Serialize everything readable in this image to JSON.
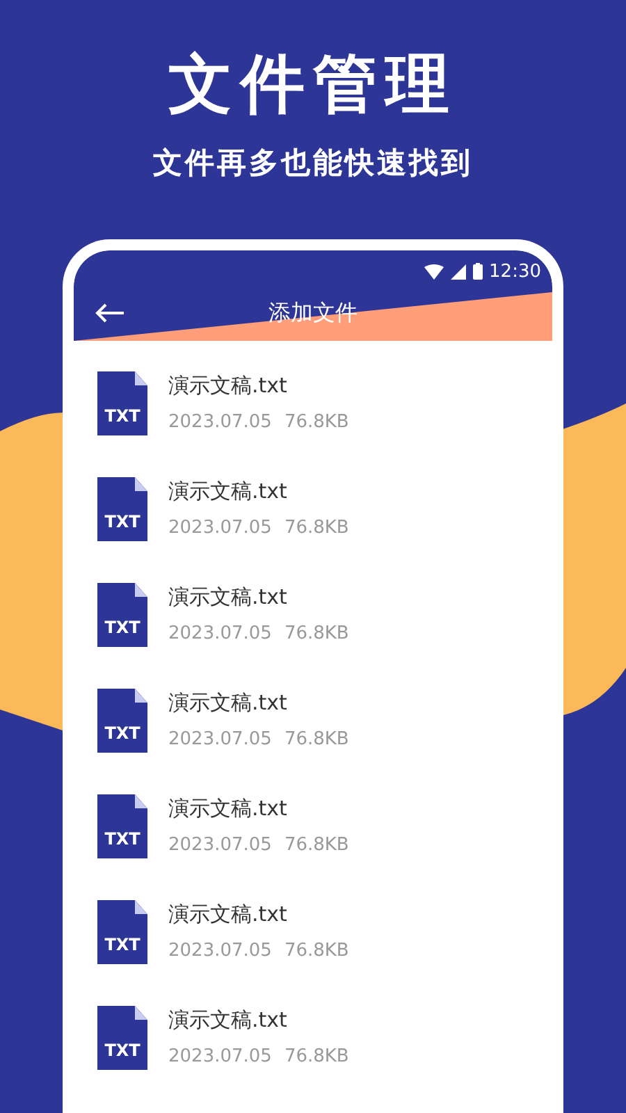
{
  "headline": "文件管理",
  "subheadline": "文件再多也能快速找到",
  "status_bar": {
    "time": "12:30"
  },
  "app_bar": {
    "title": "添加文件"
  },
  "files": [
    {
      "icon_label": "TXT",
      "name": "演示文稿.txt",
      "date": "2023.07.05",
      "size": "76.8KB"
    },
    {
      "icon_label": "TXT",
      "name": "演示文稿.txt",
      "date": "2023.07.05",
      "size": "76.8KB"
    },
    {
      "icon_label": "TXT",
      "name": "演示文稿.txt",
      "date": "2023.07.05",
      "size": "76.8KB"
    },
    {
      "icon_label": "TXT",
      "name": "演示文稿.txt",
      "date": "2023.07.05",
      "size": "76.8KB"
    },
    {
      "icon_label": "TXT",
      "name": "演示文稿.txt",
      "date": "2023.07.05",
      "size": "76.8KB"
    },
    {
      "icon_label": "TXT",
      "name": "演示文稿.txt",
      "date": "2023.07.05",
      "size": "76.8KB"
    },
    {
      "icon_label": "TXT",
      "name": "演示文稿.txt",
      "date": "2023.07.05",
      "size": "76.8KB"
    }
  ]
}
